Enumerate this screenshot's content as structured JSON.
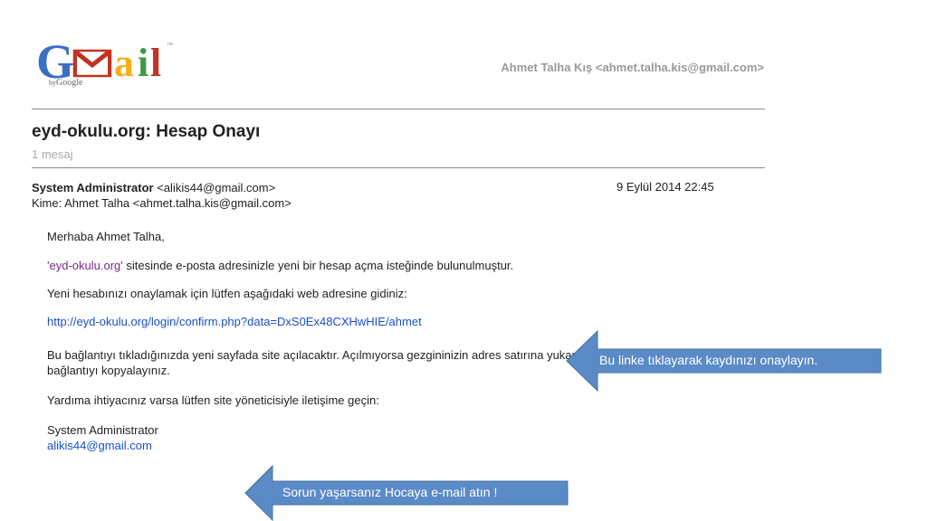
{
  "logo": {
    "by": "by",
    "google": "Google",
    "tm": "™"
  },
  "account": {
    "name": "Ahmet Talha Kış",
    "email": "<ahmet.talha.kis@gmail.com>"
  },
  "subject": "eyd-okulu.org: Hesap Onayı",
  "message_count": "1 mesaj",
  "message": {
    "sender_name": "System Administrator",
    "sender_email": "<alikis44@gmail.com>",
    "date": "9 Eylül 2014 22:45",
    "to": "Kime: Ahmet Talha <ahmet.talha.kis@gmail.com>",
    "greeting": "Merhaba Ahmet Talha,",
    "p1_site": "'eyd-okulu.org'",
    "p1_rest": " sitesinde e-posta adresinizle yeni bir hesap açma isteğinde bulunulmuştur.",
    "p2": "Yeni hesabınızı onaylamak için lütfen aşağıdaki web adresine gidiniz:",
    "confirm_link": "http://eyd-okulu.org/login/confirm.php?data=DxS0Ex48CXHwHIE/ahmet",
    "p3_line1": "Bu bağlantıyı tıkladığınızda yeni sayfada site açılacaktır. Açılmıyorsa gezgininizin adres satırına yukarıdaki",
    "p3_line2": "bağlantıyı kopyalayınız.",
    "p4": "Yardıma ihtiyacınız varsa lütfen site yöneticisiyle iletişime geçin:",
    "signature_name": "System Administrator",
    "signature_email": "alikis44@gmail.com"
  },
  "callouts": {
    "link_hint": "Bu linke tıklayarak kaydınızı onaylayın.",
    "mail_hint": "Sorun yaşarsanız Hocaya e-mail atın !"
  },
  "colors": {
    "callout_fill": "#5b8bc6",
    "callout_stroke": "#41719c",
    "link": "#1a4fc9"
  }
}
